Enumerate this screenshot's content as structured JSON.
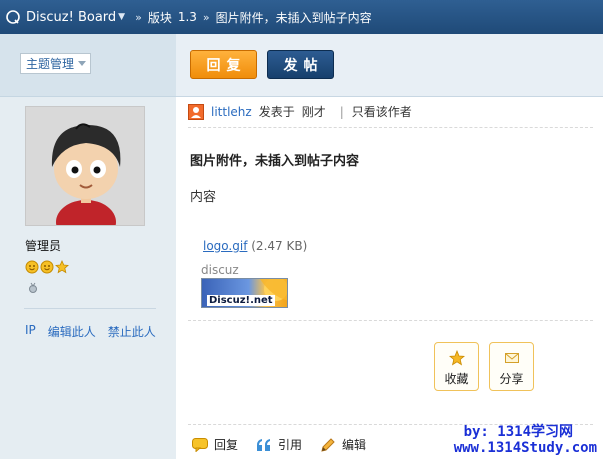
{
  "topbar": {
    "board": "Discuz! Board",
    "crumbs": [
      "版块",
      "1.3",
      "图片附件，未插入到帖子内容"
    ]
  },
  "sidebar": {
    "theme_label": "主题管理",
    "role": "管理员",
    "links": [
      "IP",
      "编辑此人",
      "禁止此人"
    ]
  },
  "toolbar": {
    "reply_label": "回复",
    "post_label": "发帖"
  },
  "post": {
    "author": "littlehz",
    "posted_at_label": "发表于",
    "posted_time": "刚才",
    "only_author_label": "只看该作者",
    "title": "图片附件，未插入到帖子内容",
    "body": "内容",
    "attachment": {
      "filename": "logo.gif",
      "size": "(2.47 KB)",
      "caption": "discuz",
      "image_text": "Discuz!.net"
    },
    "actions": {
      "favorite_label": "收藏",
      "share_label": "分享"
    },
    "bottom": {
      "reply_label": "回复",
      "quote_label": "引用",
      "edit_label": "编辑"
    }
  },
  "watermark": {
    "line1": "by: 1314学习网",
    "line2": "www.1314Study.com"
  },
  "colors": {
    "topbar": "#1f4a78",
    "sidebar": "#e5edf2",
    "link": "#2a6bbf",
    "reply_button": "#f08d0a",
    "post_button": "#17406d"
  }
}
